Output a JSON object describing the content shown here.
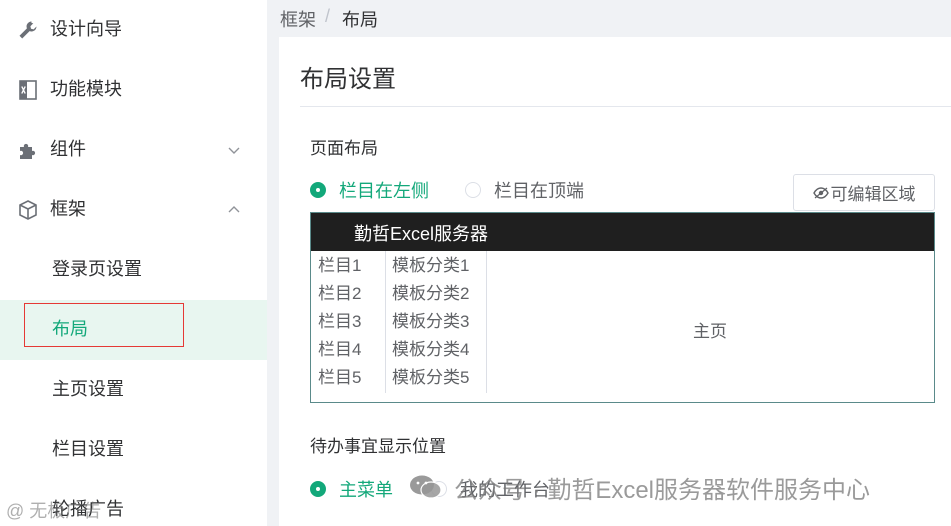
{
  "sidebar": {
    "items": [
      {
        "label": "设计向导",
        "icon": "wrench-icon"
      },
      {
        "label": "功能模块",
        "icon": "excel-module-icon"
      },
      {
        "label": "组件",
        "icon": "puzzle-icon",
        "expanded": false
      },
      {
        "label": "框架",
        "icon": "cube-icon",
        "expanded": true
      }
    ],
    "sub_items": [
      {
        "label": "登录页设置"
      },
      {
        "label": "布局",
        "active": true
      },
      {
        "label": "主页设置"
      },
      {
        "label": "栏目设置"
      },
      {
        "label": "轮播广告"
      }
    ]
  },
  "breadcrumb": {
    "parent": "框架",
    "separator": "/",
    "current": "布局"
  },
  "page": {
    "title": "布局设置"
  },
  "layout_section": {
    "label": "页面布局",
    "options": [
      {
        "label": "栏目在左侧",
        "checked": true
      },
      {
        "label": "栏目在顶端",
        "checked": false
      }
    ],
    "edit_button": "可编辑区域"
  },
  "preview": {
    "header_title": "勤哲Excel服务器",
    "columns": [
      "栏目1",
      "栏目2",
      "栏目3",
      "栏目4",
      "栏目5"
    ],
    "categories": [
      "模板分类1",
      "模板分类2",
      "模板分类3",
      "模板分类4",
      "模板分类5"
    ],
    "main_label": "主页"
  },
  "todo_section": {
    "label": "待办事宜显示位置",
    "options": [
      {
        "label": "主菜单",
        "checked": true
      },
      {
        "label": "我的工作台",
        "checked": false
      }
    ]
  },
  "watermark": {
    "text": "公众号 · 勤哲Excel服务器软件服务中心",
    "corner_text": "@ 无极广告"
  },
  "colors": {
    "accent": "#13a87a",
    "active_bg": "#e8f6f0",
    "header_dark": "#1f1f1f",
    "highlight_box": "#e53935"
  }
}
